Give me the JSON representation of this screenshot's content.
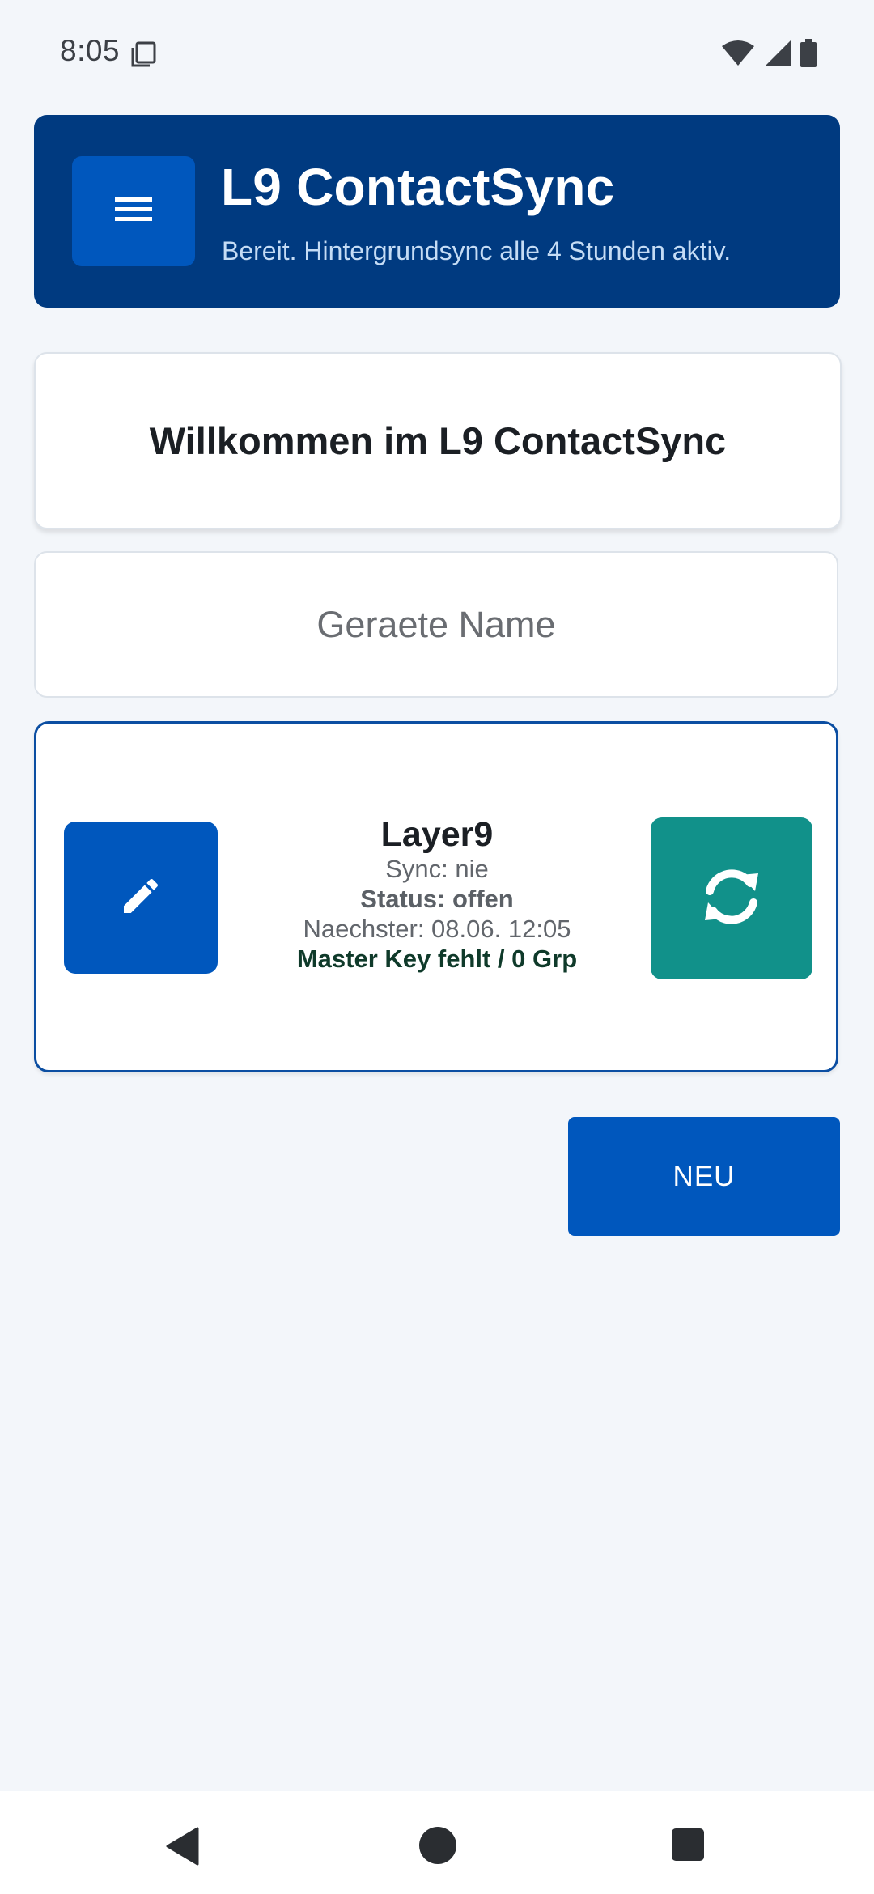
{
  "status_bar": {
    "time": "8:05",
    "icons": [
      "notification-icon",
      "wifi-icon",
      "signal-icon",
      "battery-icon"
    ]
  },
  "header": {
    "title": "L9 ContactSync",
    "subtitle": "Bereit. Hintergrundsync alle 4 Stunden aktiv.",
    "menu_icon": "hamburger-menu-icon"
  },
  "welcome": {
    "text": "Willkommen im L9 ContactSync"
  },
  "device_input": {
    "placeholder": "Geraete Name",
    "value": ""
  },
  "device_card": {
    "name": "Layer9",
    "sync": "Sync: nie",
    "status": "Status: offen",
    "next": "Naechster: 08.06. 12:05",
    "master": "Master Key fehlt / 0 Grp",
    "edit_icon": "pencil-icon",
    "sync_icon": "sync-icon"
  },
  "actions": {
    "new_label": "NEU"
  },
  "colors": {
    "header_bg": "#003a80",
    "primary": "#0057bd",
    "sync_accent": "#11918a",
    "background": "#f3f6fa"
  }
}
